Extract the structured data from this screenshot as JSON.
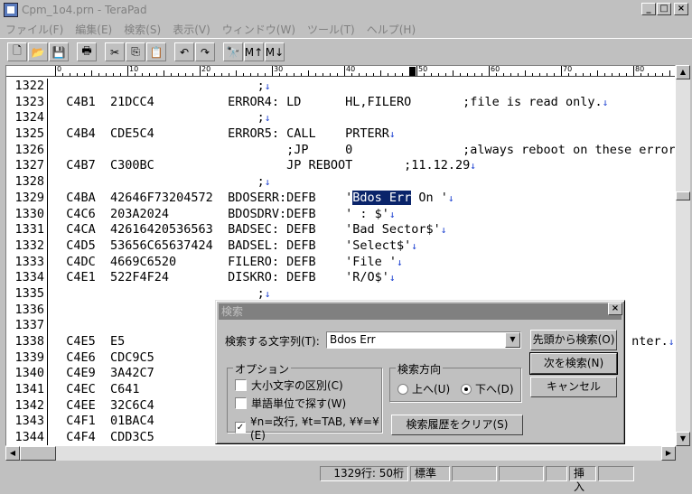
{
  "window": {
    "title": "Cpm_1o4.prn - TeraPad",
    "min_glyph": "_",
    "max_glyph": "□",
    "close_glyph": "×"
  },
  "menu": [
    "ファイル(F)",
    "編集(E)",
    "検索(S)",
    "表示(V)",
    "ウィンドウ(W)",
    "ツール(T)",
    "ヘルプ(H)"
  ],
  "toolbar": {
    "icons": [
      "new-file-icon",
      "open-folder-icon",
      "save-icon",
      "print-icon",
      "cut-icon",
      "copy-icon",
      "paste-icon",
      "undo-icon",
      "redo-icon",
      "find-icon",
      "find-prev-icon",
      "find-next-icon"
    ],
    "glyphs": [
      "🗋",
      "📂",
      "💾",
      "🖶",
      "✂",
      "⎘",
      "📋",
      "↶",
      "↷",
      "🔭",
      "M↑",
      "M↓"
    ]
  },
  "ruler": {
    "labels": [
      "0",
      "10",
      "20",
      "30",
      "40",
      "50",
      "60",
      "70",
      "80"
    ]
  },
  "editor": {
    "eol": "↓",
    "lines": [
      {
        "n": "1322",
        "t": "                            ;",
        "eol": true
      },
      {
        "n": "1323",
        "t": "  C4B1  21DCC4          ERROR4: LD      HL,FILERO       ;file is read only.",
        "eol": true
      },
      {
        "n": "1324",
        "t": "                            ;",
        "eol": true
      },
      {
        "n": "1325",
        "t": "  C4B4  CDE5C4          ERROR5: CALL    PRTERR",
        "eol": true
      },
      {
        "n": "1326",
        "t": "                                ;JP     0               ;always reboot on these errors",
        "eol": false
      },
      {
        "n": "1327",
        "t": "  C4B7  C300BC                  JP REBOOT       ;11.12.29",
        "eol": true
      },
      {
        "n": "1328",
        "t": "                            ;",
        "eol": true
      },
      {
        "n": "1329",
        "t": "  C4BA  42646F73204572  BDOSERR:DEFB    '",
        "hl": "Bdos Err",
        "after": " On '",
        "eol": true
      },
      {
        "n": "1330",
        "t": "  C4C6  203A2024        BDOSDRV:DEFB    ' : $'",
        "eol": true
      },
      {
        "n": "1331",
        "t": "  C4CA  42616420536563  BADSEC: DEFB    'Bad Sector$'",
        "eol": true
      },
      {
        "n": "1332",
        "t": "  C4D5  53656C65637424  BADSEL: DEFB    'Select$'",
        "eol": true
      },
      {
        "n": "1333",
        "t": "  C4DC  4669C6520       FILERO: DEFB    'File '",
        "eol": true
      },
      {
        "n": "1334",
        "t": "  C4E1  522F4F24        DISKRO: DEFB    'R/O$'",
        "eol": true
      },
      {
        "n": "1335",
        "t": "                            ;",
        "eol": true
      },
      {
        "n": "1336",
        "t": "",
        "eol": false
      },
      {
        "n": "1337",
        "t": "",
        "eol": false
      },
      {
        "n": "1338",
        "t": "  C4E5  E5                                                                     nter.",
        "eol": true
      },
      {
        "n": "1339",
        "t": "  C4E6  CDC9C5",
        "eol": false
      },
      {
        "n": "1340",
        "t": "  C4E9  3A42C7",
        "eol": false
      },
      {
        "n": "1341",
        "t": "  C4EC  C641",
        "eol": false
      },
      {
        "n": "1342",
        "t": "  C4EE  32C6C4",
        "eol": false
      },
      {
        "n": "1343",
        "t": "  C4F1  01BAC4",
        "eol": false
      },
      {
        "n": "1344",
        "t": "  C4F4  CDD3C5",
        "eol": false
      }
    ]
  },
  "status": {
    "position": "1329行:  50桁",
    "mode": "標準",
    "insert": "挿入"
  },
  "find_dialog": {
    "title": "検索",
    "search_label": "検索する文字列(T):",
    "search_value": "Bdos Err",
    "options_label": "オプション",
    "opt_case": "大小文字の区別(C)",
    "opt_word": "単語単位で探す(W)",
    "opt_escape": "¥n=改行, ¥t=TAB, ¥¥=¥(E)",
    "opt_case_checked": false,
    "opt_word_checked": false,
    "opt_escape_checked": true,
    "direction_label": "検索方向",
    "dir_up": "上へ(U)",
    "dir_down": "下へ(D)",
    "dir_selected": "down",
    "btn_from_top": "先頭から検索(O)",
    "btn_next": "次を検索(N)",
    "btn_cancel": "キャンセル",
    "btn_clear_history": "検索履歴をクリア(S)",
    "check_glyph": "✓"
  }
}
